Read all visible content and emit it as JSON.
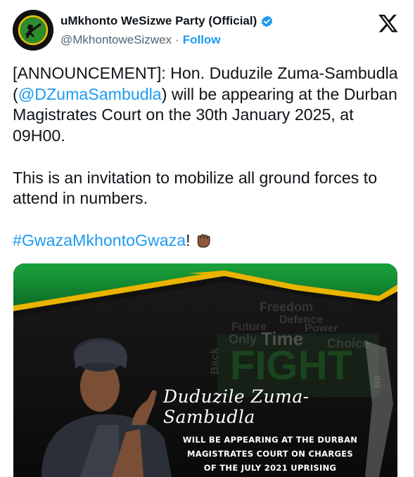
{
  "account": {
    "display_name": "uMkhonto WeSizwe Party (Official)",
    "handle": "@MkhontoweSizwex",
    "separator": "·",
    "follow_label": "Follow"
  },
  "tweet": {
    "line1_prefix": "[ANNOUNCEMENT]: Hon. Duduzile Zuma-Sambudla (",
    "mention": "@DZumaSambudla",
    "line1_suffix": ") will be appearing at the Durban Magistrates Court on the 30th January 2025, at 09H00.",
    "line2": "This is an invitation to mobilize all ground forces to attend in numbers.",
    "hashtag": "#GwazaMkhontoGwaza",
    "hashtag_suffix": "!"
  },
  "media": {
    "script_name": "Duduzile Zuma-Sambudla",
    "court_lines": [
      "WILL BE APPEARING AT THE DURBAN",
      "MAGISTRATES COURT ON CHARGES",
      "OF THE JULY 2021 UPRISING"
    ],
    "background_words": {
      "freedom": "Freedom",
      "defence": "Defence",
      "future": "Future",
      "power": "Power",
      "only": "Only",
      "time": "Time",
      "choice": "Choice",
      "fight": "FIGHT",
      "back": "Back",
      "hit": "Hit"
    }
  },
  "colors": {
    "link": "#1d9bf0",
    "verified": "#1d9bf0",
    "green": "#1f9b3a",
    "gold": "#e8b400"
  }
}
